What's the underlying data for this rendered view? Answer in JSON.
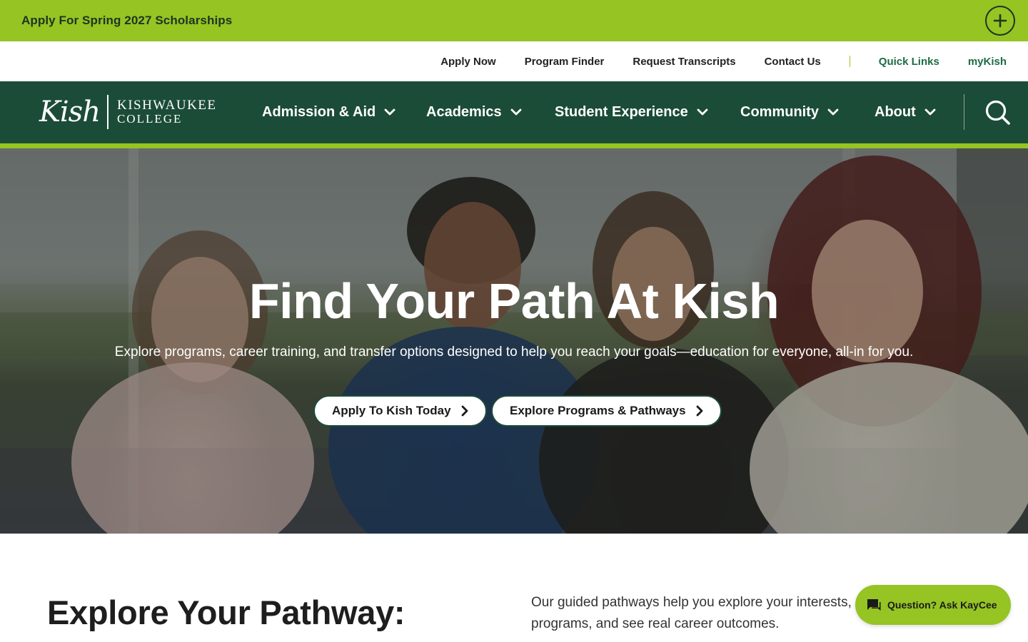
{
  "alert": {
    "text": "Apply For Spring 2027 Scholarships"
  },
  "utility_nav": {
    "links": [
      "Apply Now",
      "Program Finder",
      "Request Transcripts",
      "Contact Us"
    ],
    "quick_links": "Quick Links",
    "mykish": "myKish"
  },
  "logo": {
    "script": "Kish",
    "line1": "KISHWAUKEE",
    "line2": "COLLEGE"
  },
  "main_nav": {
    "items": [
      "Admission & Aid",
      "Academics",
      "Student Experience",
      "Community",
      "About"
    ]
  },
  "hero": {
    "title": "Find Your Path At Kish",
    "subtitle": "Explore programs, career training, and transfer options designed to help you reach your goals—education for everyone, all-in for you.",
    "primary_button": "Apply To Kish Today",
    "secondary_button": "Explore Programs & Pathways"
  },
  "pathway": {
    "title": "Explore Your Pathway:",
    "description": "Our guided pathways help you explore your interests, match them to programs, and see real career outcomes."
  },
  "chat": {
    "label": "Question? Ask KayCee"
  },
  "colors": {
    "accent_green": "#95c423",
    "brand_dark_green": "#1b4c37",
    "link_green": "#1c6b43"
  }
}
